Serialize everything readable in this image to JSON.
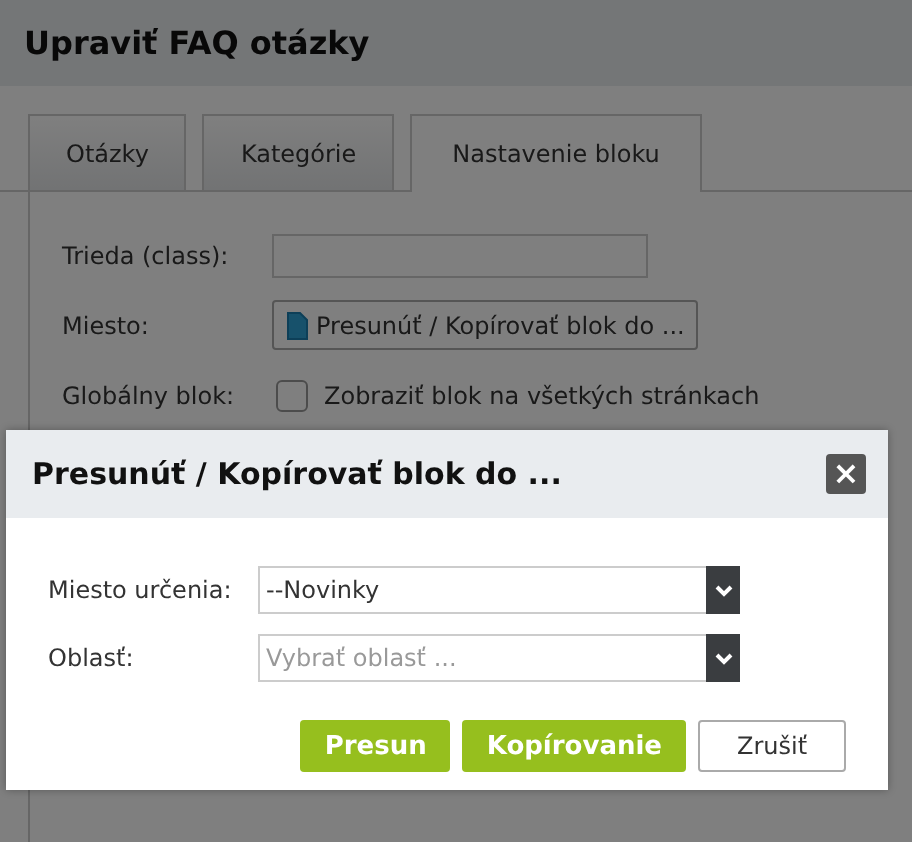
{
  "page": {
    "title": "Upraviť FAQ otázky"
  },
  "tabs": [
    {
      "label": "Otázky",
      "selected": false
    },
    {
      "label": "Kategórie",
      "selected": false
    },
    {
      "label": "Nastavenie bloku",
      "selected": true
    }
  ],
  "form": {
    "class_label": "Trieda (class):",
    "place_label": "Miesto:",
    "place_button": "Presunúť / Kopírovať blok do ...",
    "global_label": "Globálny blok:",
    "global_checkbox": {
      "label": "Zobraziť blok na všetkých stránkach",
      "checked": false
    }
  },
  "dialog": {
    "title": "Presunúť / Kopírovať blok do ...",
    "close": "×",
    "fields": [
      {
        "label": "Miesto určenia:",
        "value": "--Novinky"
      },
      {
        "label": "Oblasť:",
        "placeholder": "Vybrať oblasť ..."
      }
    ],
    "buttons": [
      {
        "label": "Presun",
        "kind": "primary"
      },
      {
        "label": "Kopírovanie",
        "kind": "primary"
      },
      {
        "label": "Zrušiť",
        "kind": "secondary"
      }
    ]
  }
}
